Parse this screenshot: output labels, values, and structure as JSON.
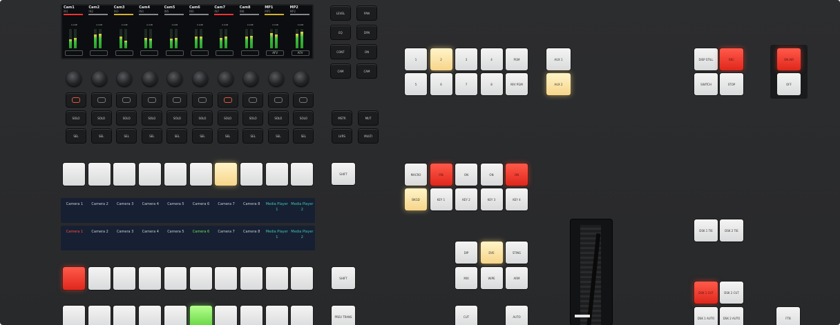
{
  "lcd": {
    "channels": [
      {
        "name": "Cam1",
        "sub": "IN1",
        "bar": "#e33",
        "gain": "0.0dB",
        "l": 0.45,
        "r": 0.55,
        "footer": ""
      },
      {
        "name": "Cam2",
        "sub": "IN2",
        "bar": "#888",
        "gain": "0.0dB",
        "l": 0.7,
        "r": 0.75,
        "footer": ""
      },
      {
        "name": "Cam3",
        "sub": "IN3",
        "bar": "#d6b32a",
        "gain": "0.0dB",
        "l": 0.6,
        "r": 0.4,
        "footer": ""
      },
      {
        "name": "Cam4",
        "sub": "IN4",
        "bar": "#888",
        "gain": "0.0dB",
        "l": 0.55,
        "r": 0.5,
        "footer": ""
      },
      {
        "name": "Cam5",
        "sub": "IN5",
        "bar": "#888",
        "gain": "0.0dB",
        "l": 0.5,
        "r": 0.55,
        "footer": ""
      },
      {
        "name": "Cam6",
        "sub": "IN6",
        "bar": "#888",
        "gain": "0.0dB",
        "l": 0.6,
        "r": 0.6,
        "footer": ""
      },
      {
        "name": "Cam7",
        "sub": "IN7",
        "bar": "#e33",
        "gain": "0.0dB",
        "l": 0.55,
        "r": 0.6,
        "footer": ""
      },
      {
        "name": "Cam8",
        "sub": "IN8",
        "bar": "#888",
        "gain": "0.0dB",
        "l": 0.6,
        "r": 0.65,
        "footer": ""
      },
      {
        "name": "MP1",
        "sub": "MP1",
        "bar": "#d6b32a",
        "gain": "0.0dB",
        "l": 0.8,
        "r": 0.7,
        "footer": "AFV"
      },
      {
        "name": "MP2",
        "sub": "MP2",
        "bar": "#888",
        "gain": "0.0dB",
        "l": 0.75,
        "r": 0.85,
        "footer": "AFV"
      }
    ]
  },
  "audio_side_buttons": [
    [
      "LEVEL",
      "PAN"
    ],
    [
      "EQ",
      "DYN"
    ],
    [
      "CONT",
      "ON"
    ],
    [
      "CAM",
      "CAM"
    ]
  ],
  "solo_labels": [
    "SOLO",
    "SOLO",
    "SOLO",
    "SOLO",
    "SOLO",
    "SOLO",
    "SOLO",
    "SOLO",
    "SOLO",
    "SOLO"
  ],
  "sel_labels": [
    "SEL",
    "SEL",
    "SEL",
    "SEL",
    "SEL",
    "SEL",
    "SEL",
    "SEL",
    "SEL",
    "SEL"
  ],
  "audio_right_buttons": [
    [
      "MSTR",
      "MUT"
    ],
    [
      "LVRS",
      "MULTI"
    ]
  ],
  "shift_labels": {
    "top": "SHIFT",
    "bottom": "SHIFT",
    "prev": "PREV TRANS"
  },
  "source_top": [
    "Camera 1",
    "Camera 2",
    "Camera 3",
    "Camera 4",
    "Camera 5",
    "Camera 6",
    "Camera 7",
    "Camera 8",
    "Media Player 1",
    "Media Player 2"
  ],
  "source_bottom": [
    "Camera 1",
    "Camera 2",
    "Camera 3",
    "Camera 4",
    "Camera 5",
    "Camera 6",
    "Camera 7",
    "Camera 8",
    "Media Player 1",
    "Media Player 2"
  ],
  "number_pad": [
    "1",
    "2",
    "3",
    "4",
    "PGM",
    "5",
    "6",
    "7",
    "8",
    "M/V PGM"
  ],
  "aux_buttons": [
    "AUX 1",
    "AUX 2"
  ],
  "macro_row1": [
    "MACRO",
    "ON",
    "ON",
    "ON",
    "ON"
  ],
  "macro_row2": [
    "BKGD",
    "KEY 1",
    "KEY 2",
    "KEY 3",
    "KEY 4"
  ],
  "transition_row1": [
    "DIP",
    "DVE",
    "STING"
  ],
  "transition_row2": [
    "MIX",
    "WIPE",
    "ARM"
  ],
  "cut_auto": [
    "CUT",
    "AUTO"
  ],
  "record_buttons": [
    "DISP STILL",
    "REC",
    "SWITCH",
    "STOP"
  ],
  "onair_buttons": [
    "ON AIR",
    "OFF"
  ],
  "dsk_buttons": [
    "DSK 1 TIE",
    "DSK 2 TIE"
  ],
  "dsk_cut": [
    "DSK 1 CUT",
    "DSK 2 CUT"
  ],
  "dsk_auto": [
    "DSK 1 AUTO",
    "DSK 2 AUTO",
    "FTB"
  ]
}
